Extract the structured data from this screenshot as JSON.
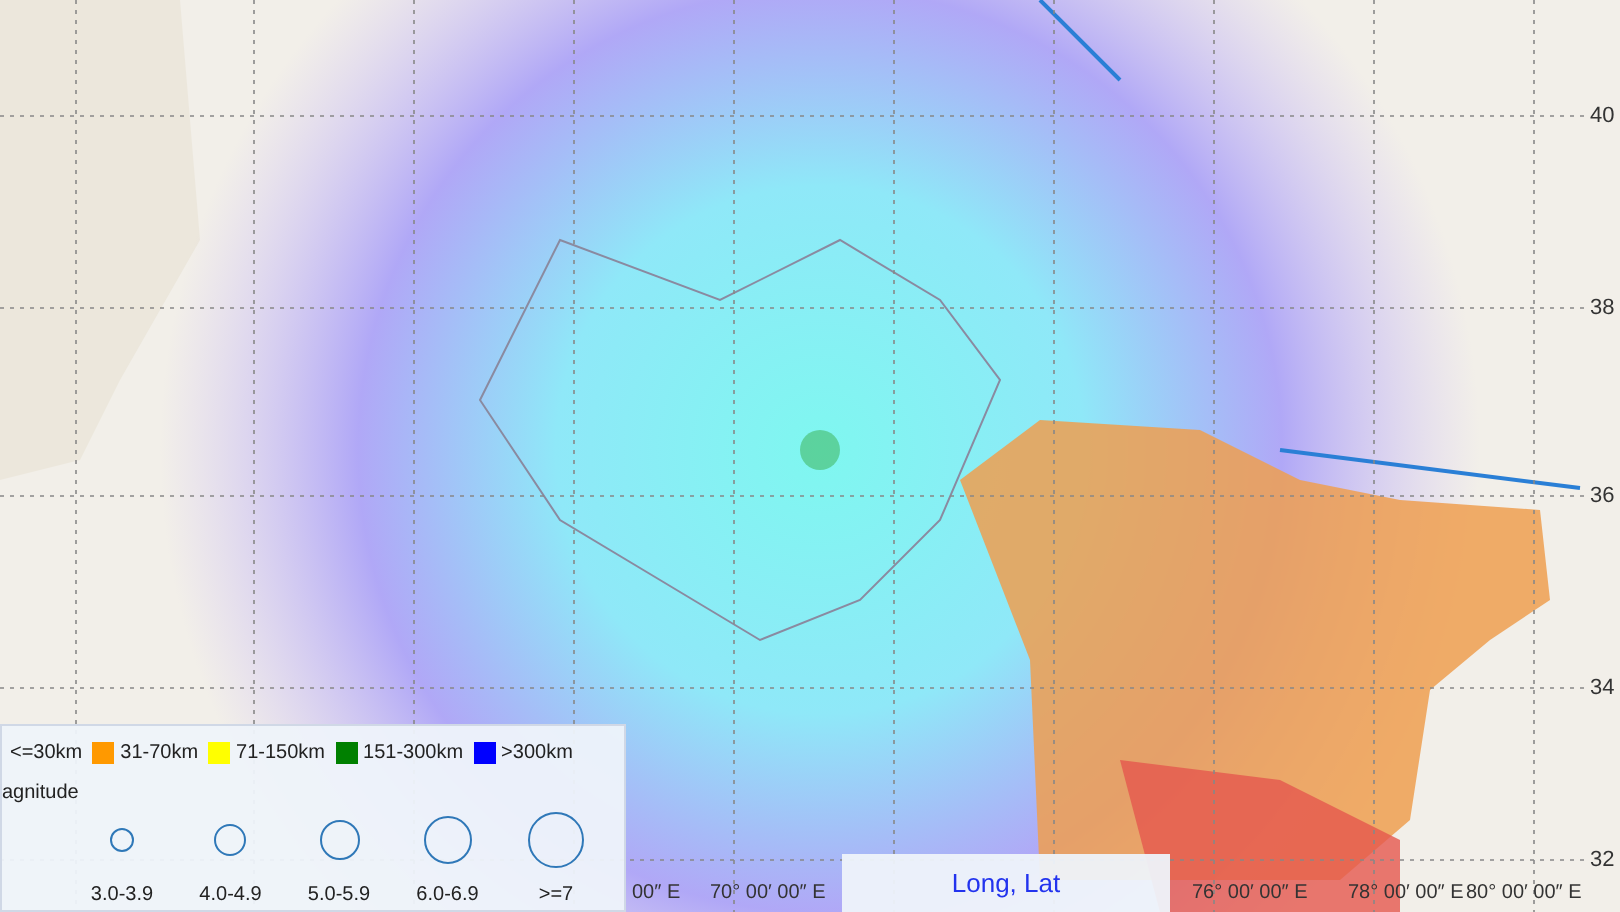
{
  "map": {
    "x_ticks": [
      "00″ E",
      "70° 00′ 00″ E",
      "76° 00′ 00″ E",
      "78° 00′ 00″ E",
      "80° 00′ 00″ E"
    ],
    "y_ticks": [
      "40",
      "38",
      "36",
      "34",
      "32"
    ]
  },
  "legend": {
    "depth_items": [
      {
        "label": "<=30km"
      },
      {
        "label": "31-70km",
        "color": "#ff9900"
      },
      {
        "label": "71-150km",
        "color": "#ffff00"
      },
      {
        "label": "151-300km",
        "color": "#008000"
      },
      {
        "label": ">300km",
        "color": "#0000ff"
      }
    ],
    "magnitude_title": "agnitude",
    "magnitude_items": [
      {
        "label": "3.0-3.9"
      },
      {
        "label": "4.0-4.9"
      },
      {
        "label": "5.0-5.9"
      },
      {
        "label": "6.0-6.9"
      },
      {
        "label": ">=7"
      }
    ]
  },
  "coordinate_label": "Long, Lat"
}
